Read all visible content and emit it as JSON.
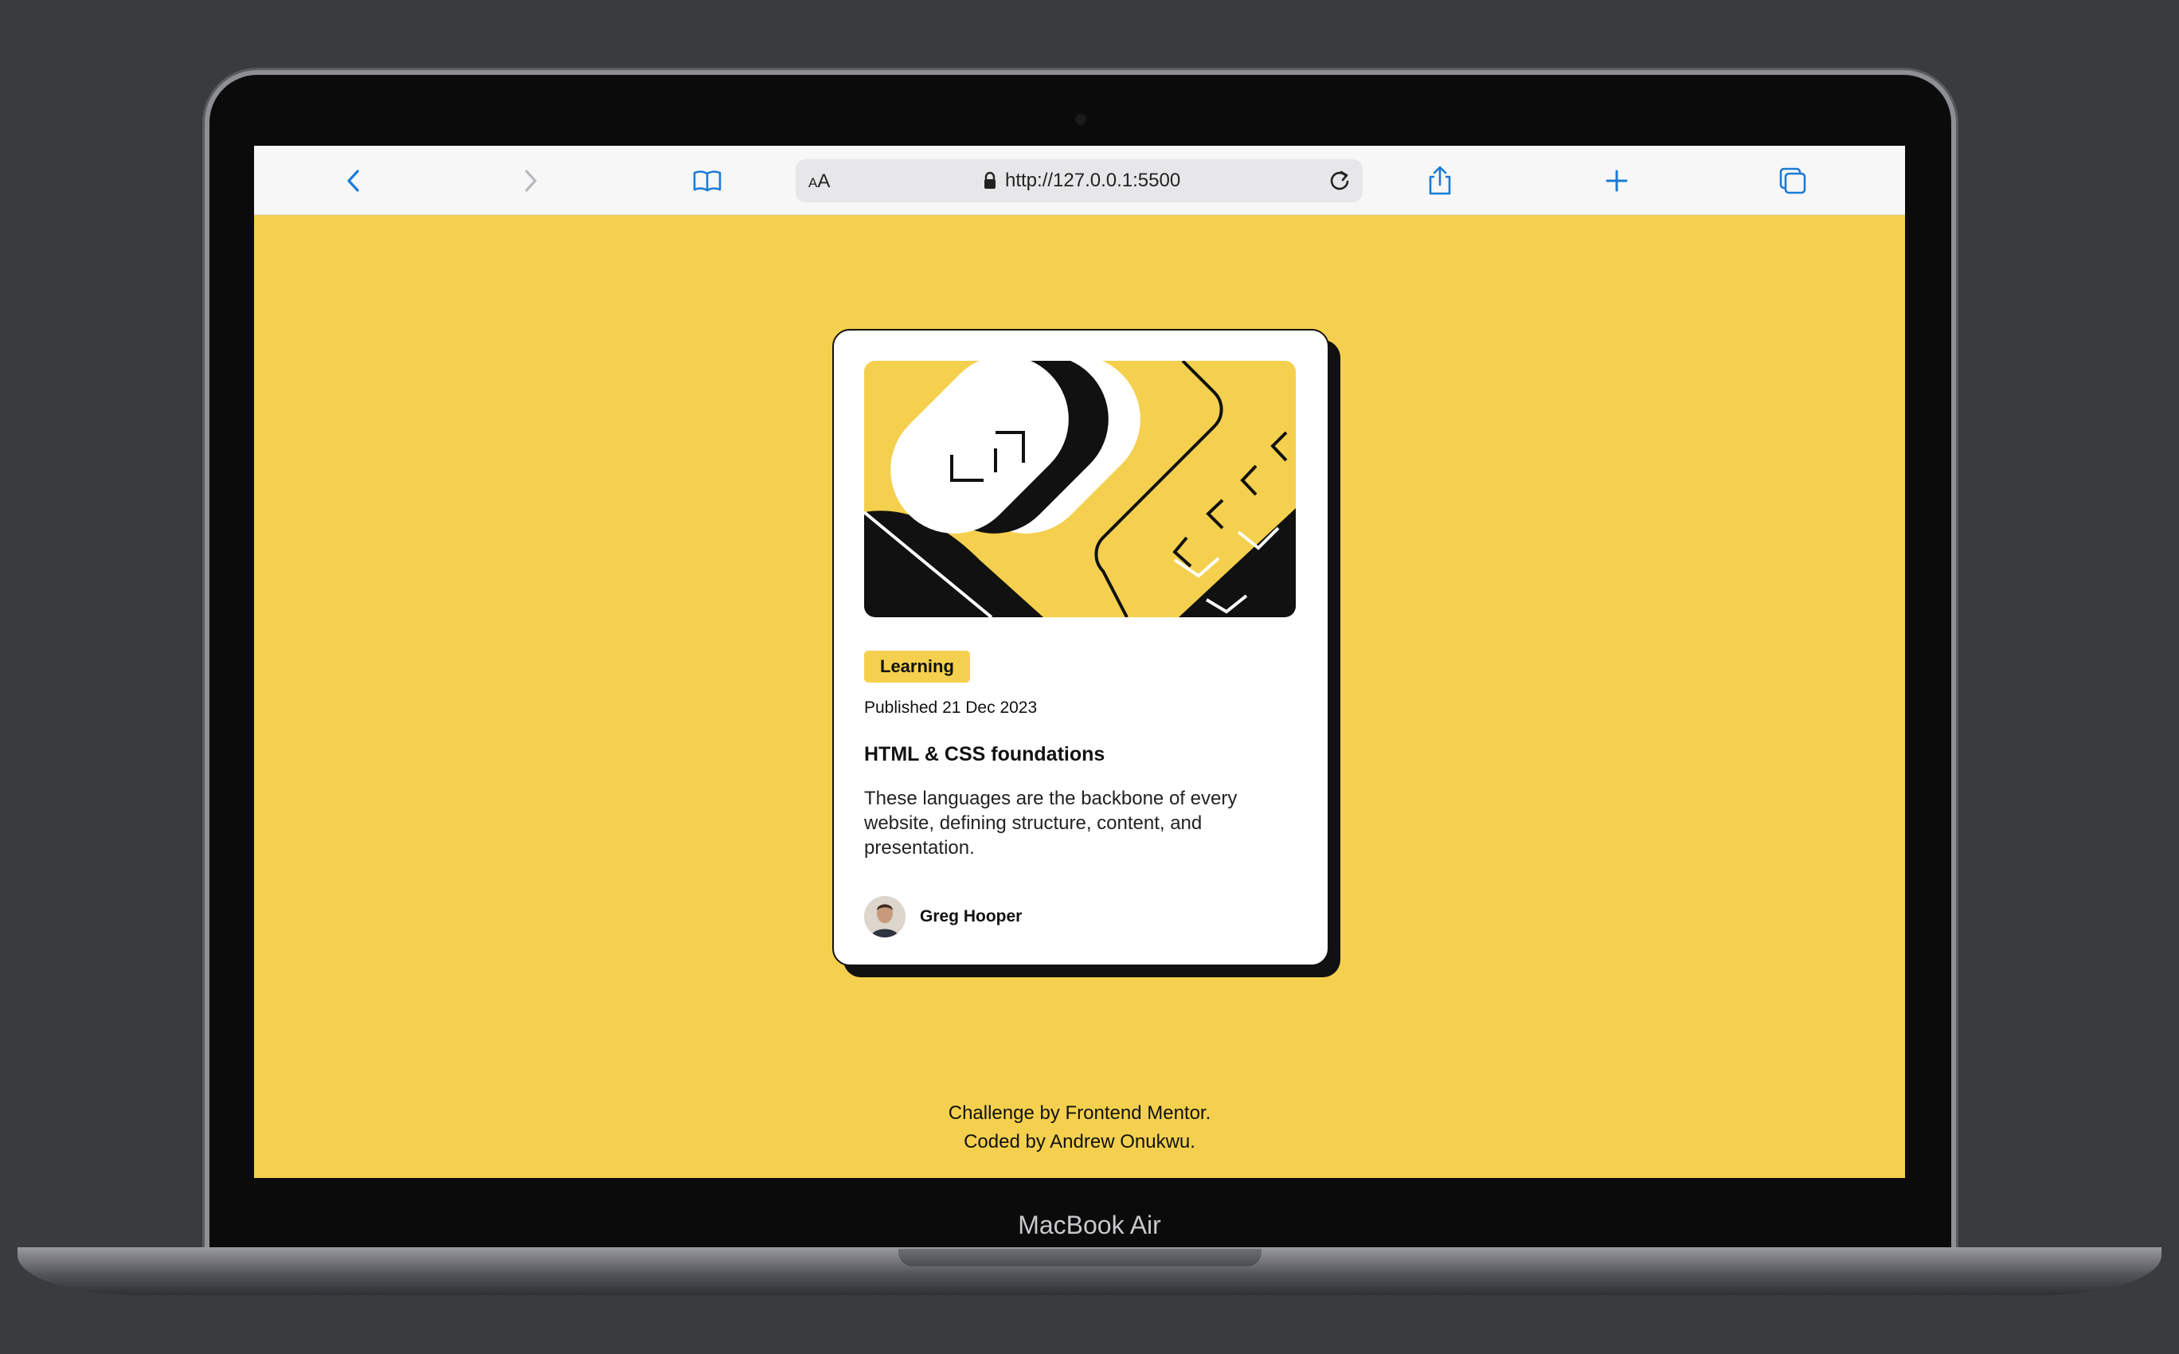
{
  "browser": {
    "address_bar": {
      "text_size_label": "AA",
      "url": "http://127.0.0.1:5500"
    }
  },
  "card": {
    "tag": "Learning",
    "published": "Published 21 Dec 2023",
    "title": "HTML & CSS foundations",
    "description": "These languages are the backbone of every website, defining structure, content, and presentation.",
    "author": "Greg Hooper"
  },
  "footer": {
    "line1": "Challenge by Frontend Mentor.",
    "line2": "Coded by Andrew Onukwu."
  },
  "device": {
    "model_label": "MacBook Air"
  },
  "colors": {
    "accent": "#f4d04e",
    "dark": "#111111",
    "browser_blue": "#1a7bd8"
  }
}
